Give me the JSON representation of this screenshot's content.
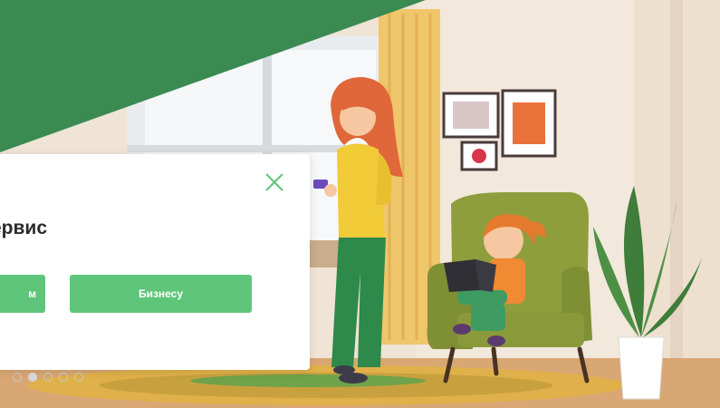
{
  "card": {
    "title_partial": "ервис",
    "left_button_partial": "м",
    "right_button_label": "Бизнесу"
  },
  "carousel": {
    "dots": [
      {
        "active": false
      },
      {
        "active": true
      },
      {
        "active": false
      },
      {
        "active": false
      },
      {
        "active": false
      }
    ]
  },
  "colors": {
    "brand_green": "#3a8a52",
    "button_green": "#5fc57a"
  },
  "icons": {
    "close": "close-icon"
  }
}
